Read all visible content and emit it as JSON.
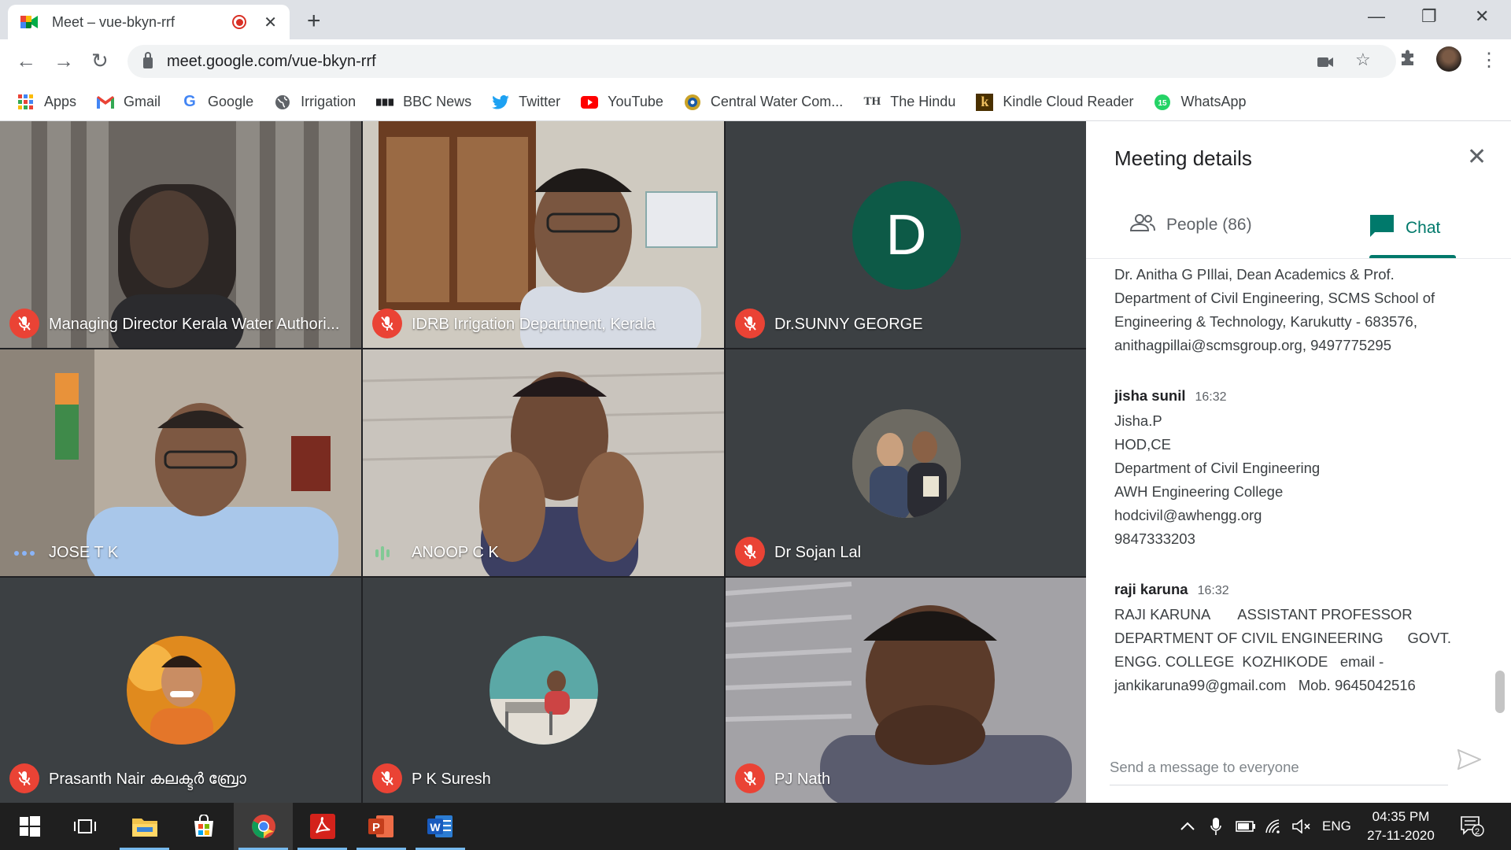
{
  "browser": {
    "tab_title": "Meet – vue-bkyn-rrf",
    "url": "meet.google.com/vue-bkyn-rrf",
    "bookmarks": [
      {
        "label": "Apps",
        "icon": "apps-grid-icon",
        "color": "#4285f4"
      },
      {
        "label": "Gmail",
        "icon": "gmail-icon",
        "color": "#ea4335"
      },
      {
        "label": "Google",
        "icon": "google-icon",
        "color": "#4285f4"
      },
      {
        "label": "Irrigation",
        "icon": "globe-icon",
        "color": "#5f6368"
      },
      {
        "label": "BBC News",
        "icon": "bbc-icon",
        "color": "#202124"
      },
      {
        "label": "Twitter",
        "icon": "twitter-icon",
        "color": "#1da1f2"
      },
      {
        "label": "YouTube",
        "icon": "youtube-icon",
        "color": "#ff0000"
      },
      {
        "label": "Central Water Com...",
        "icon": "cwc-emblem-icon",
        "color": "#c9a227"
      },
      {
        "label": "The Hindu",
        "icon": "the-hindu-icon",
        "color": "#202124"
      },
      {
        "label": "Kindle Cloud Reader",
        "icon": "kindle-icon",
        "color": "#8a5a00"
      },
      {
        "label": "WhatsApp",
        "icon": "whatsapp-icon",
        "color": "#25d366"
      }
    ]
  },
  "meet": {
    "tiles": [
      {
        "name": "Managing Director Kerala Water Authori...",
        "status": "muted",
        "type": "video"
      },
      {
        "name": "IDRB Irrigation Department, Kerala",
        "status": "muted",
        "type": "video"
      },
      {
        "name": "Dr.SUNNY GEORGE",
        "status": "muted",
        "type": "letter",
        "letter": "D"
      },
      {
        "name": "JOSE T K",
        "status": "more",
        "type": "video"
      },
      {
        "name": "ANOOP C K",
        "status": "speaking",
        "type": "video"
      },
      {
        "name": "Dr Sojan Lal",
        "status": "muted",
        "type": "avatar"
      },
      {
        "name": "Prasanth Nair കലക്ടർ ബ്രോ",
        "status": "muted",
        "type": "avatar"
      },
      {
        "name": "P K Suresh",
        "status": "muted",
        "type": "avatar"
      },
      {
        "name": "PJ Nath",
        "status": "muted",
        "type": "video"
      }
    ]
  },
  "panel": {
    "title": "Meeting details",
    "people_tab": "People (86)",
    "chat_tab": "Chat",
    "accent": "#00796b",
    "chat_lines_top": [
      "Dr. Anitha G PIllai, Dean Academics & Prof.",
      "Department of Civil Engineering, SCMS School of",
      "Engineering & Technology, Karukutty - 683576,",
      "anithagpillai@scmsgroup.org, 9497775295"
    ],
    "messages": [
      {
        "sender": "jisha sunil",
        "time": "16:32",
        "lines": [
          "Jisha.P",
          "HOD,CE",
          "Department of Civil Engineering",
          "AWH Engineering College",
          "hodcivil@awhengg.org",
          "9847333203"
        ]
      },
      {
        "sender": "raji karuna",
        "time": "16:32",
        "lines": [
          "RAJI KARUNA       ASSISTANT PROFESSOR",
          "DEPARTMENT OF CIVIL ENGINEERING      GOVT.",
          "ENGG. COLLEGE  KOZHIKODE   email -",
          "jankikaruna99@gmail.com   Mob. 9645042516"
        ]
      }
    ],
    "composer_placeholder": "Send a message to everyone"
  },
  "taskbar": {
    "language": "ENG",
    "time": "04:35 PM",
    "date": "27-11-2020",
    "notification_count": "2"
  }
}
